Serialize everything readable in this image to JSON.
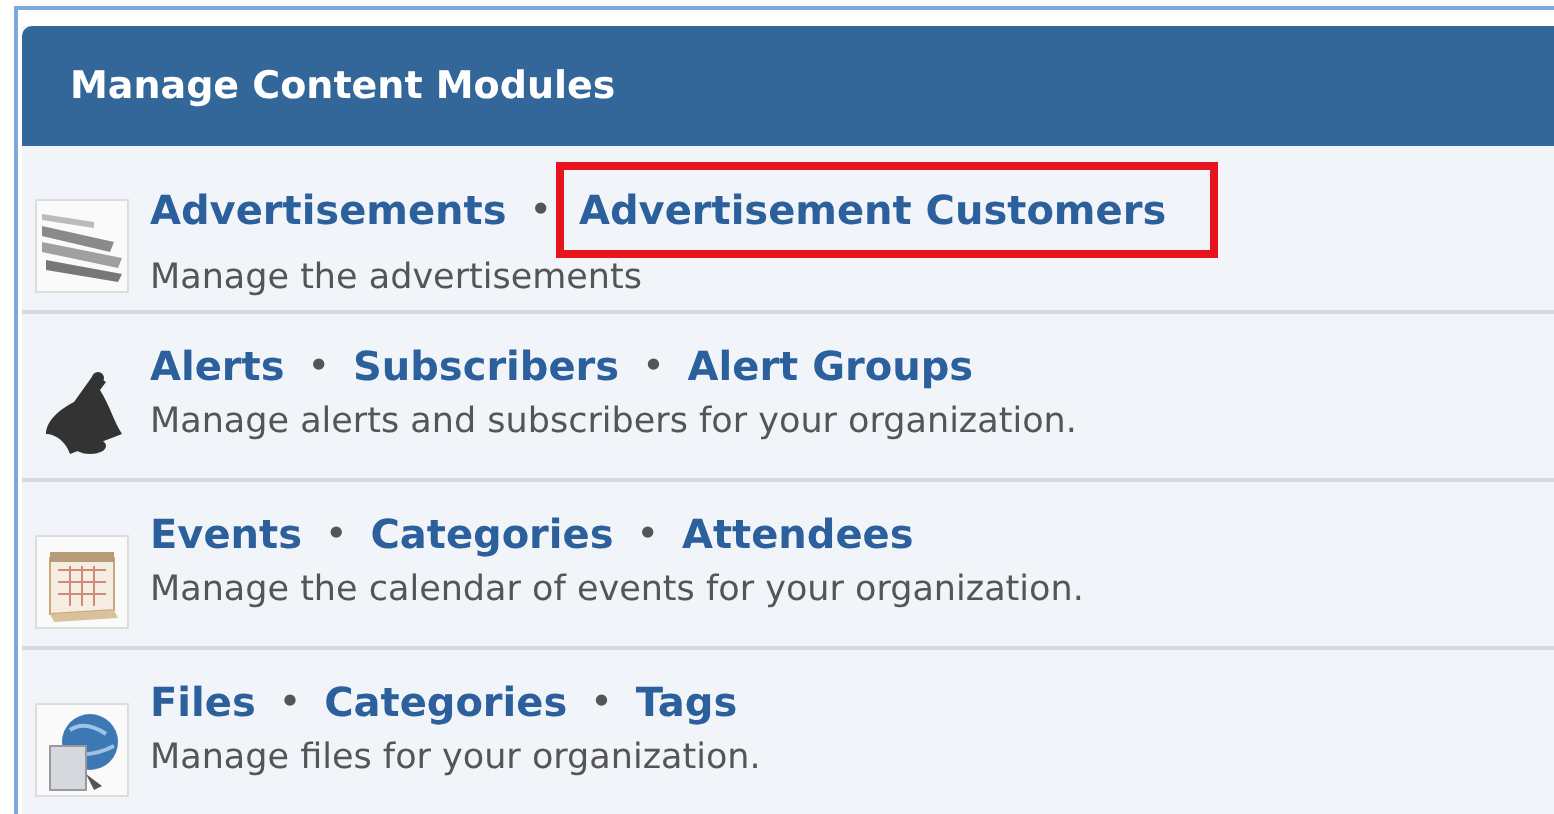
{
  "panel": {
    "title": "Manage Content Modules"
  },
  "modules": [
    {
      "links": [
        {
          "label": "Advertisements",
          "highlighted": false
        },
        {
          "label": "Advertisement Customers",
          "highlighted": true
        }
      ],
      "separator": "•",
      "description": "Manage the advertisements"
    },
    {
      "links": [
        {
          "label": "Alerts",
          "highlighted": false
        },
        {
          "label": "Subscribers",
          "highlighted": false
        },
        {
          "label": "Alert Groups",
          "highlighted": false
        }
      ],
      "separator": "•",
      "description": "Manage alerts and subscribers for your organization."
    },
    {
      "links": [
        {
          "label": "Events",
          "highlighted": false
        },
        {
          "label": "Categories",
          "highlighted": false
        },
        {
          "label": "Attendees",
          "highlighted": false
        }
      ],
      "separator": "•",
      "description": "Manage the calendar of events for your organization."
    },
    {
      "links": [
        {
          "label": "Files",
          "highlighted": false
        },
        {
          "label": "Categories",
          "highlighted": false
        },
        {
          "label": "Tags",
          "highlighted": false
        }
      ],
      "separator": "•",
      "description": "Manage files for your organization."
    }
  ]
}
